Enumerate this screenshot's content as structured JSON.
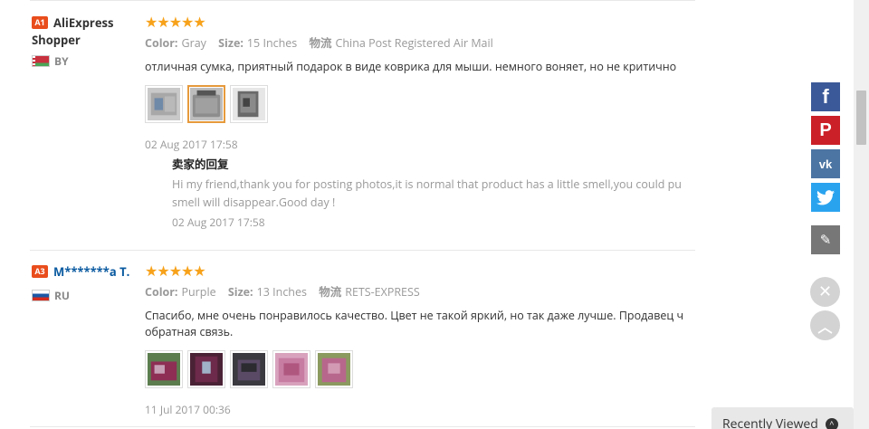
{
  "reviews": [
    {
      "level_badge": "A1",
      "buyer_name": "AliExpress Shopper",
      "country_code": "BY",
      "attributes": [
        {
          "key": "Color:",
          "value": "Gray"
        },
        {
          "key": "Size:",
          "value": "15 Inches"
        },
        {
          "key": "物流",
          "value": "China Post Registered Air Mail"
        }
      ],
      "text_lines": [
        "отличная сумка, приятный подарок в виде коврика для мыши. немного воняет, но не критично"
      ],
      "date": "02 Aug 2017 17:58",
      "reply": {
        "title": "卖家的回复",
        "text_lines": [
          "Hi my friend,thank you for posting photos,it is normal that product has a little smell,you could pu",
          "smell will disappear.Good day !"
        ],
        "date": "02 Aug 2017 17:58"
      }
    },
    {
      "level_badge": "A3",
      "buyer_name": "M*******a T.",
      "country_code": "RU",
      "attributes": [
        {
          "key": "Color:",
          "value": "Purple"
        },
        {
          "key": "Size:",
          "value": "13 Inches"
        },
        {
          "key": "物流",
          "value": "RETS-EXPRESS"
        }
      ],
      "text_lines": [
        "Спасибо, мне очень понравилось качество. Цвет не такой яркий, но так даже лучше. Продавец ч",
        "обратная связь."
      ],
      "date": "11 Jul 2017 00:36"
    }
  ],
  "stars_text": "★★★★★",
  "share_icons": {
    "facebook": "f",
    "pinterest": "P",
    "vk": "vk",
    "twitter": "twitter-bird-icon",
    "edit": "✎"
  },
  "float_buttons": {
    "close": "✕",
    "up": "︿"
  },
  "recently_viewed": {
    "label": "Recently Viewed",
    "icon": "^"
  }
}
